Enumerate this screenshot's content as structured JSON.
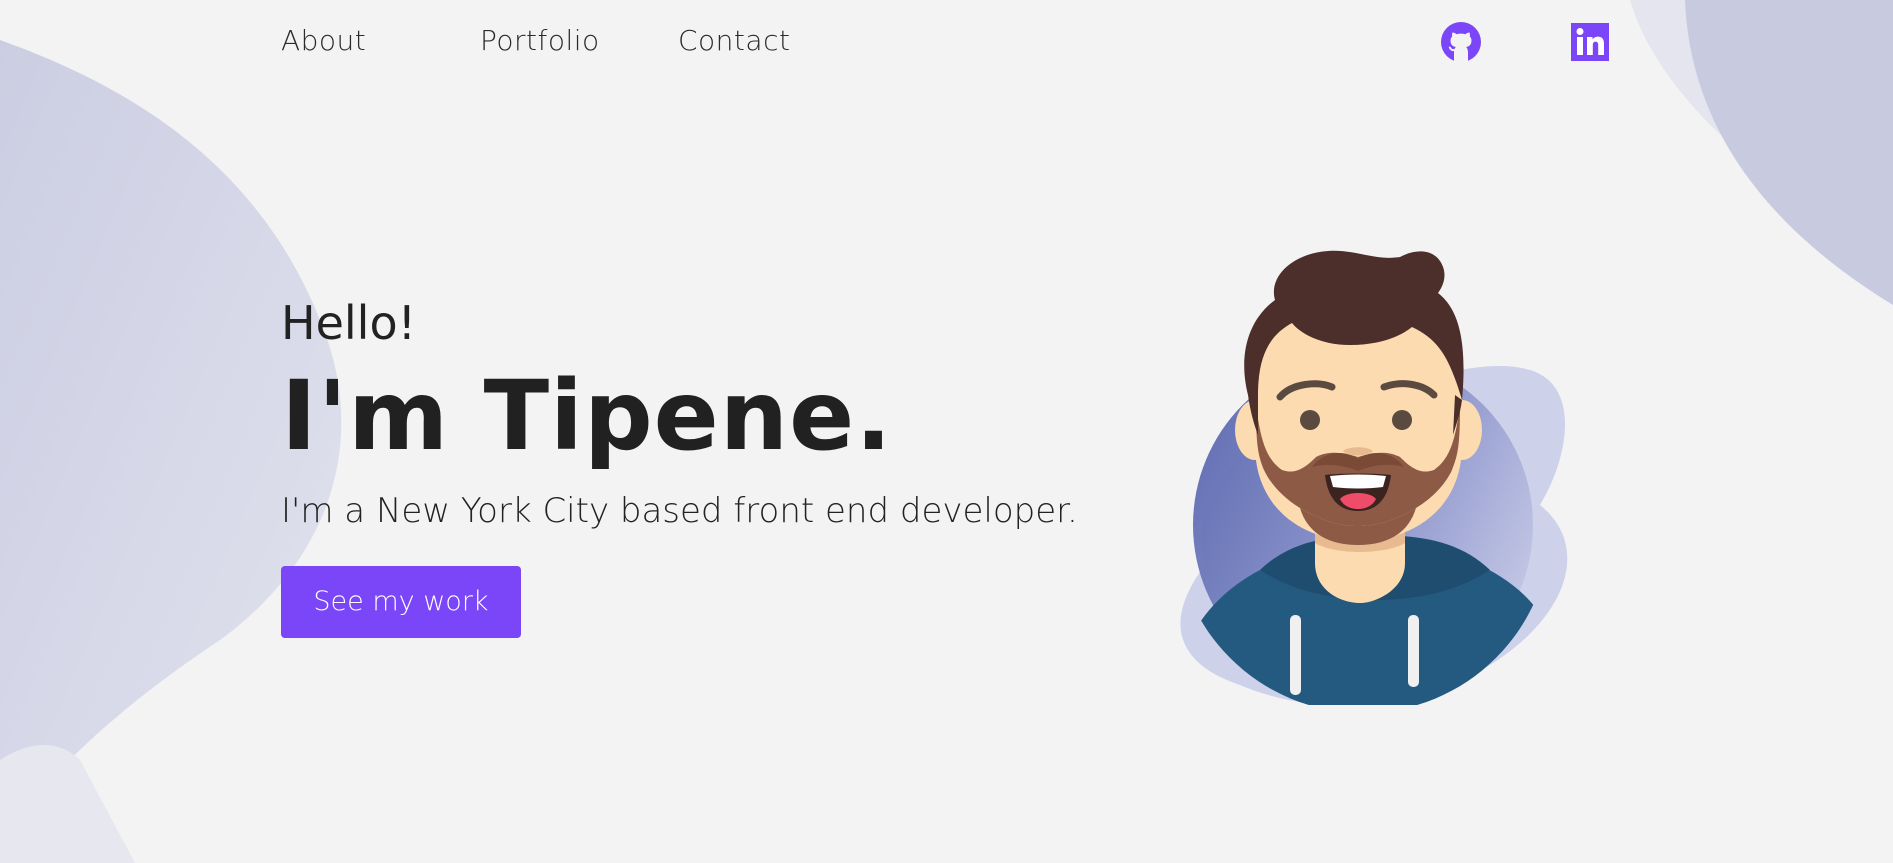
{
  "nav": {
    "links": [
      {
        "label": "About"
      },
      {
        "label": "Portfolio"
      },
      {
        "label": "Contact"
      }
    ],
    "social": [
      {
        "icon": "github-icon"
      },
      {
        "icon": "linkedin-icon"
      }
    ]
  },
  "hero": {
    "greeting": "Hello!",
    "name": "I'm Tipene.",
    "tagline": "I'm a New York City based front end developer.",
    "cta_label": "See my work"
  },
  "colors": {
    "accent": "#7b45f8",
    "background": "#f3f3f3",
    "blob": "#cdd0e3",
    "hoodie": "#255a80",
    "hair": "#4c2f2a"
  }
}
